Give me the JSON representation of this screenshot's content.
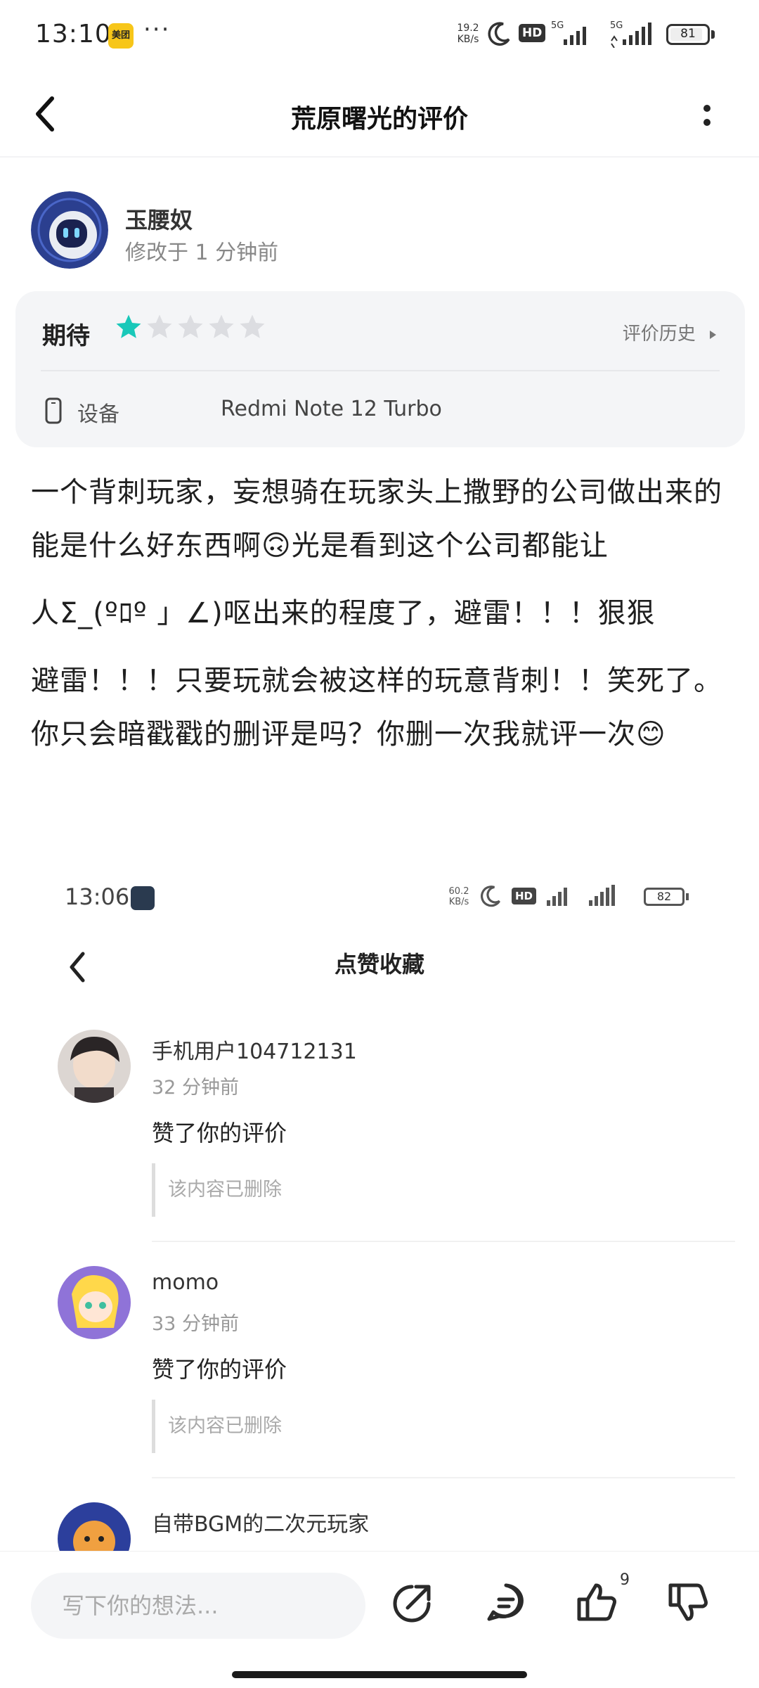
{
  "status_bar": {
    "time": "13:10",
    "app_badge": "美团",
    "more": "···",
    "net_speed_value": "19.2",
    "net_speed_unit": "KB/s",
    "hd_label": "HD",
    "signal1_label": "5G",
    "signal2_label": "5G",
    "battery": "81"
  },
  "nav": {
    "title": "荒原曙光的评价"
  },
  "author": {
    "name": "玉腰奴",
    "modified": "修改于 1 分钟前"
  },
  "rating": {
    "label": "期待",
    "stars_filled": 1,
    "stars_total": 5,
    "star_color": "#19c8b9",
    "history_label": "评价历史",
    "device_label": "设备",
    "device_value": "Redmi Note 12 Turbo"
  },
  "review": {
    "para1": "一个背刺玩家，妄想骑在玩家头上撒野的公司做出来的能是什么好东西啊🙃光是看到这个公司都能让",
    "para2": "人Σ_(ºﾛº 」∠)呕出来的程度了，避雷！！！狠狠",
    "para3": "避雷！！！只要玩就会被这样的玩意背刺！！笑死了。你只会暗戳戳的删评是吗？你删一次我就评一次😊"
  },
  "embedded": {
    "status": {
      "time": "13:06",
      "net_speed_value": "60.2",
      "net_speed_unit": "KB/s",
      "hd_label": "HD",
      "battery": "82"
    },
    "title": "点赞收藏",
    "notifications": [
      {
        "user": "手机用户104712131",
        "time": "32 分钟前",
        "action": "赞了你的评价",
        "quote": "该内容已删除"
      },
      {
        "user": "momo",
        "time": "33 分钟前",
        "action": "赞了你的评价",
        "quote": "该内容已删除"
      },
      {
        "user": "自带BGM的二次元玩家"
      }
    ]
  },
  "bottom_bar": {
    "input_placeholder": "写下你的想法...",
    "like_count": "9"
  }
}
